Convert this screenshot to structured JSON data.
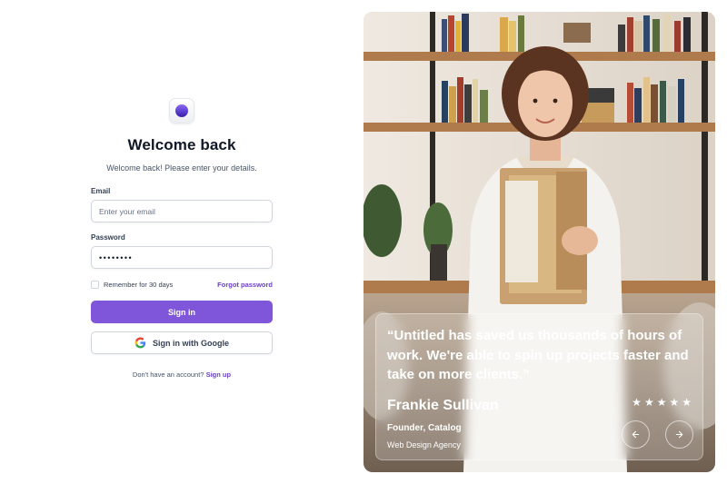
{
  "login": {
    "title": "Welcome back",
    "subtitle": "Welcome back! Please enter your details.",
    "email_label": "Email",
    "email_placeholder": "Enter your email",
    "password_label": "Password",
    "password_value": "••••••••",
    "remember_label": "Remember for 30 days",
    "forgot_label": "Forgot password",
    "signin_label": "Sign in",
    "google_label": "Sign in with Google",
    "signup_prompt": "Don't have an account?",
    "signup_link": "Sign up"
  },
  "testimonial": {
    "quote": "“Untitled has saved us thousands of hours of work. We're able to spin up projects  faster and take on more clients.”",
    "author": "Frankie Sullivan",
    "role": "Founder, Catalog",
    "company": "Web Design Agency",
    "rating": 5,
    "stars": [
      "★",
      "★",
      "★",
      "★",
      "★"
    ],
    "prev_icon": "arrow-left-icon",
    "next_icon": "arrow-right-icon"
  },
  "colors": {
    "accent": "#7f56d9",
    "link": "#6941c6"
  }
}
